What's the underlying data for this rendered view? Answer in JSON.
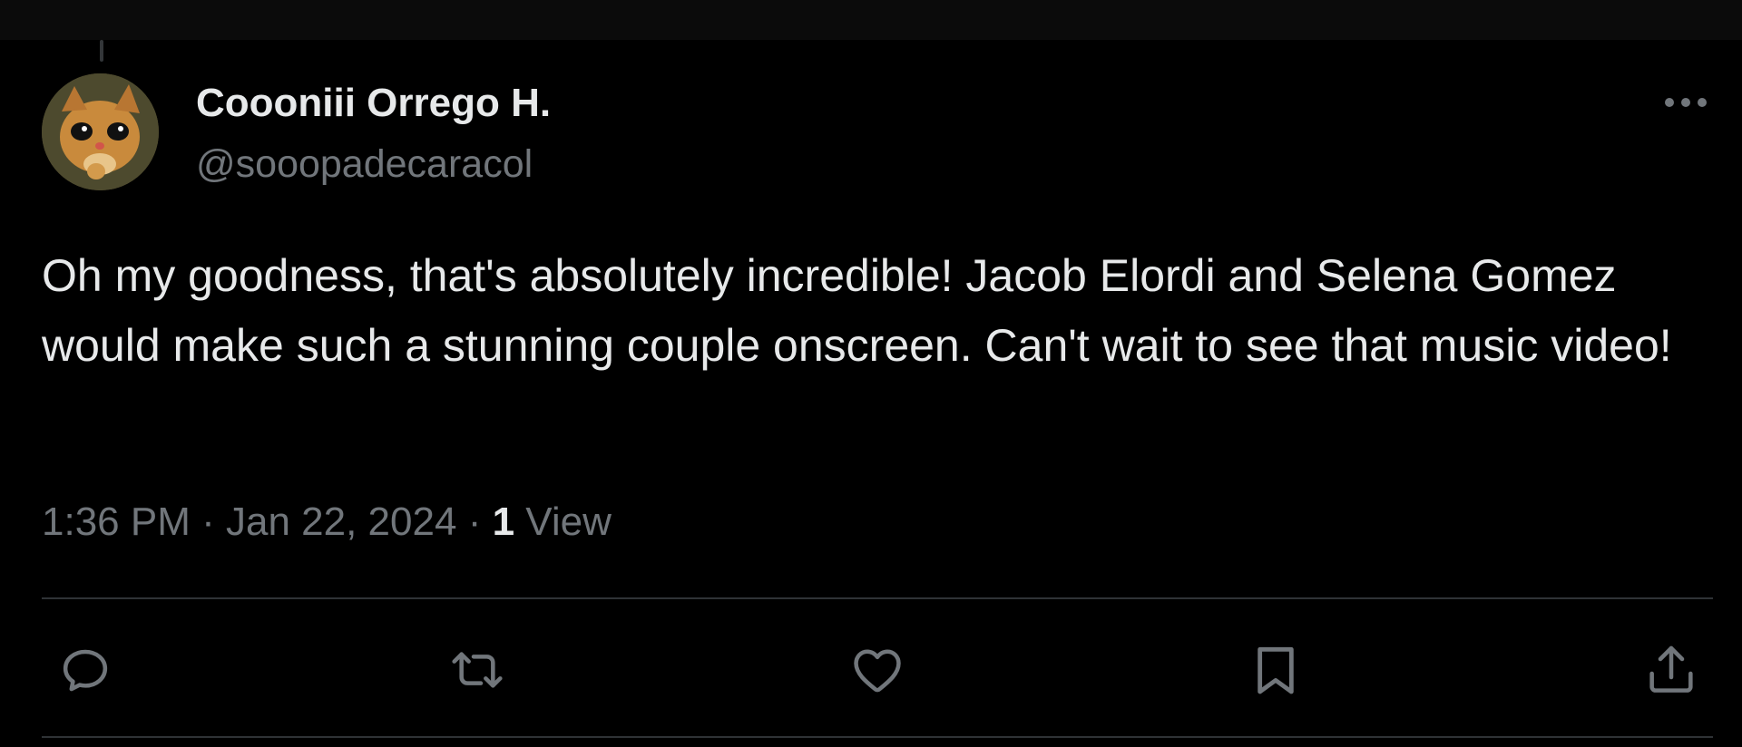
{
  "tweet": {
    "author": {
      "display_name": "Coooniii Orrego H.",
      "handle": "@sooopadecaracol",
      "avatar_icon": "cat-avatar"
    },
    "text": "Oh my goodness, that's absolutely incredible! Jacob Elordi and Selena Gomez would make such a stunning couple onscreen. Can't wait to see that music video!",
    "time": "1:36 PM",
    "separator": "·",
    "date": "Jan 22, 2024",
    "views_count": "1",
    "views_label": "View"
  },
  "actions": [
    {
      "name": "reply",
      "icon": "reply-icon"
    },
    {
      "name": "retweet",
      "icon": "retweet-icon"
    },
    {
      "name": "like",
      "icon": "heart-icon"
    },
    {
      "name": "bookmark",
      "icon": "bookmark-icon"
    },
    {
      "name": "share",
      "icon": "share-icon"
    }
  ],
  "more_icon": "more-horizontal-icon",
  "colors": {
    "background": "#000000",
    "text_primary": "#e7e9ea",
    "text_secondary": "#71767b",
    "divider": "#2f3336"
  }
}
